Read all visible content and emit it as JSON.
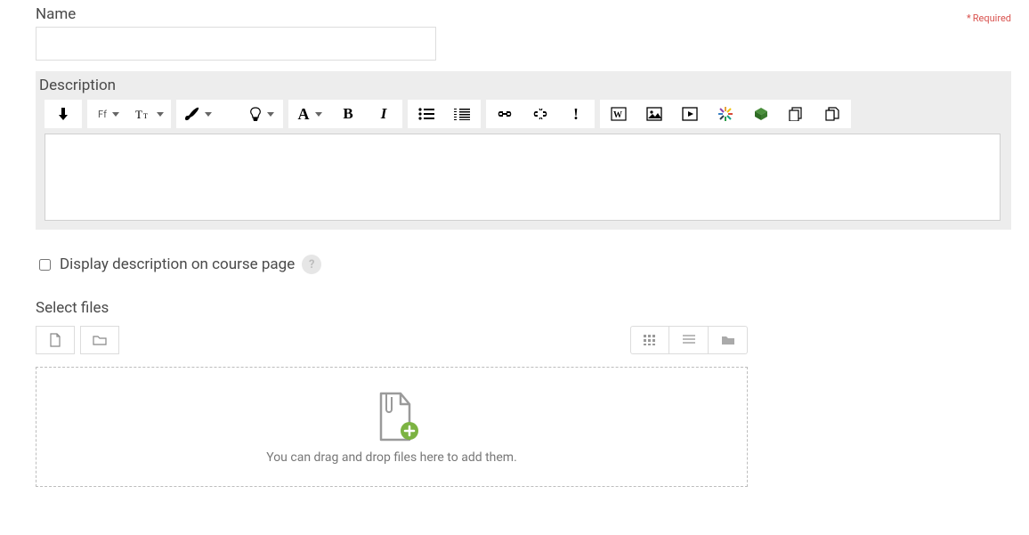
{
  "name": {
    "label": "Name",
    "value": ""
  },
  "required_hint": "Required",
  "description": {
    "label": "Description"
  },
  "toolbar": {
    "more": "↓",
    "font_family": "Ff",
    "font_size": "T",
    "letter_a": "A",
    "bold": "B",
    "italic": "I",
    "exclaim": "!",
    "word_w": "W"
  },
  "display_checkbox": {
    "label": "Display description on course page",
    "checked": false,
    "help": "?"
  },
  "files": {
    "label": "Select files",
    "dropzone_text": "You can drag and drop files here to add them."
  }
}
